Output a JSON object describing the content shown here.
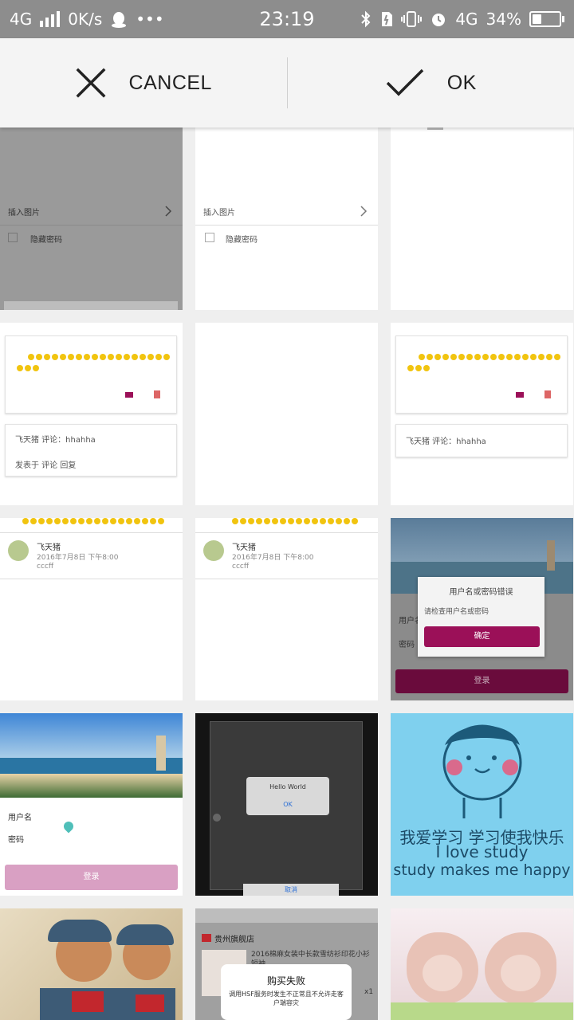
{
  "status_bar": {
    "network": "4G",
    "speed": "0K/s",
    "more": "•••",
    "time": "23:19",
    "right_network": "4G",
    "battery_percent": "34%",
    "battery_level": 34
  },
  "action_bar": {
    "cancel_label": "CANCEL",
    "ok_label": "OK"
  },
  "tiles": {
    "t1": {
      "row1": "插入图片",
      "row2": "隐藏密码"
    },
    "t2": {
      "row1": "插入图片",
      "row2": "隐藏密码"
    },
    "t4": {
      "row1": "飞天猪  评论：hhahha",
      "row2": "发表于  评论  回复"
    },
    "t6": {
      "row1": "飞天猪  评论：hhahha"
    },
    "t7": {
      "name": "飞天猪",
      "meta": "2016年7月8日 下午8:00",
      "row": "cccff"
    },
    "t8": {
      "name": "飞天猪",
      "meta": "2016年7月8日 下午8:00",
      "row": "cccff"
    },
    "t9": {
      "dialog_title": "用户名或密码错误",
      "dialog_body": "请检查用户名或密码",
      "dialog_button": "确定",
      "row1": "用户名",
      "row2": "密码",
      "submit": "登录"
    },
    "t10": {
      "row1": "用户名",
      "row2": "密码",
      "submit": "登录"
    },
    "t11": {
      "dialog_title": "Hello World",
      "dialog_ok": "OK",
      "bottom": "取消"
    },
    "t12": {
      "line1": "我爱学习 学习使我快乐",
      "line2": "I love study",
      "line3": "study makes me happy"
    },
    "t14": {
      "store": "贵州旗舰店",
      "title": "2016棉麻女装中长款雪纺衫印花小衫短袖",
      "qty": "x1",
      "toast_title": "购买失败",
      "toast_body": "调用HSF服务时发生不正常且不允许走客户端容灾"
    }
  },
  "colors": {
    "status_bg": "#8d8d8d",
    "action_bg": "#f4f4f4",
    "accent_magenta": "#9b1058",
    "pink": "#d9a0c3",
    "sky": "#7fd0ee"
  },
  "icons": {
    "cancel": "close-icon",
    "ok": "check-icon"
  }
}
